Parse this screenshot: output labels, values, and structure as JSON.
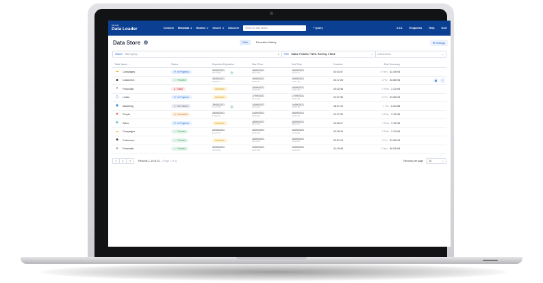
{
  "app": {
    "brand_small": "Mosaic",
    "brand_title": "Data Loader",
    "nav": [
      "Connect",
      "Metadata",
      "Monitor",
      "Secure",
      "Discover"
    ],
    "nav_chevron": [
      "",
      "v",
      "v",
      "v",
      ""
    ],
    "search_placeholder": "Search for data assets...",
    "query_label": "+ Query",
    "right_nav": [
      "2.4.1",
      "Endpoints",
      "Help",
      "User"
    ]
  },
  "page": {
    "title": "Data Store",
    "tabs": [
      "Jobs",
      "Execution History"
    ],
    "active_tab": 0,
    "settings_label": "Settings"
  },
  "filters": {
    "search_label": "Search",
    "search_placeholder": "Start typing...",
    "filter_label": "Filter",
    "filter_value": "Status: Finished, Failed, Running, 3 More",
    "connections_label": "Connections"
  },
  "table": {
    "columns": [
      "Table Name ↑",
      "Status",
      "Expected Expiration",
      "Start Time",
      "End Time",
      "Duration",
      "Disk Summary"
    ],
    "rows": [
      {
        "icon": "☁",
        "icon_color": "#f0b52a",
        "name": "Campaigns",
        "status": "In Progress",
        "status_type": "prog",
        "exp_date": "25/05/2021",
        "exp_time": "09:44:08",
        "exp_cycle": true,
        "start_date": "18/09/2021",
        "start_time": "09:44:08",
        "end_date": "18/09/2021",
        "end_time": "11:22:27",
        "duration": "03:03:47",
        "files": "6 Files",
        "size": "42.45 KB",
        "actions": false
      },
      {
        "icon": "■",
        "icon_color": "#222",
        "name": "Customers",
        "status": "Finished",
        "status_type": "fin",
        "exp_date": "30/05/2021",
        "exp_time": "09:53:17",
        "exp_cycle": false,
        "start_date": "19/09/2021",
        "start_time": "09:53:17",
        "end_date": "19/09/2021",
        "end_time": "13:47:33",
        "duration": "03:17:25",
        "files": "1 File",
        "size": "33.56 KB",
        "actions": true
      },
      {
        "icon": "✈",
        "icon_color": "#8a6d3b",
        "name": "Financials",
        "status": "Failed",
        "status_type": "fail",
        "exp_date": "",
        "exp_time": "",
        "exp_cycle": false,
        "start_date": "15/09/2021",
        "start_time": "12:32:34",
        "end_date": "15/09/2021",
        "end_time": "14:07:23",
        "duration": "03:32:38",
        "files": "2 Files",
        "size": "2.31 KB",
        "actions": false
      },
      {
        "icon": "⬡",
        "icon_color": "#2b7bd6",
        "name": "Leads",
        "status": "In Progress",
        "status_type": "prog",
        "exp_date": "",
        "exp_time": "",
        "exp_cycle": false,
        "start_date": "17/09/2021",
        "start_time": "14:17:03",
        "end_date": "17/09/2021",
        "end_time": "16:24:35",
        "duration": "01:37:35",
        "files": "1 File",
        "size": "23.56 KB",
        "actions": false
      },
      {
        "icon": "◉",
        "icon_color": "#2b7bd6",
        "name": "Marketing",
        "status": "Not Started",
        "status_type": "ns",
        "exp_date": "29/05/2021",
        "exp_time": "14:17:09",
        "exp_cycle": true,
        "start_date": "14/09/2021",
        "start_time": "13:22:27",
        "end_date": "14/09/2021",
        "end_time": "16:48:23",
        "duration": "08:37:19",
        "files": "1 File",
        "size": "4.03 MB",
        "actions": false
      },
      {
        "icon": "▼",
        "icon_color": "#e0453a",
        "name": "People",
        "status": "Cancelled",
        "status_type": "cancel",
        "exp_date": "25/05/2021",
        "exp_time": "10:02:31",
        "exp_cycle": false,
        "start_date": "14/09/2021",
        "start_time": "10:42:11",
        "end_date": "16/09/2021",
        "end_time": "11:47:48",
        "duration": "01:37:32",
        "files": "3 Files",
        "size": "3.76 KB",
        "actions": false
      },
      {
        "icon": "❀",
        "icon_color": "#3aa4c9",
        "name": "Sales",
        "status": "In Progress",
        "status_type": "prog",
        "exp_date": "",
        "exp_time": "",
        "exp_cycle": false,
        "start_date": "18/09/2021",
        "start_time": "11:07:03",
        "end_date": "18/09/2021",
        "end_time": "09:13:57",
        "duration": "04:56:17",
        "files": "7 Files",
        "size": "3.76 KB",
        "actions": false
      },
      {
        "icon": "☁",
        "icon_color": "#f0b52a",
        "name": "Campaigns",
        "status": "Finished",
        "status_type": "fin",
        "exp_date": "26/05/2021",
        "exp_time": "14:47:21",
        "exp_cycle": false,
        "start_date": "15/09/2021",
        "start_time": "10:47:21",
        "end_date": "15/09/2021",
        "end_time": "17:19:25",
        "duration": "02:25:19",
        "files": "5 Files",
        "size": "2.31 KB",
        "actions": false
      },
      {
        "icon": "■",
        "icon_color": "#222",
        "name": "Customers",
        "status": "Finished",
        "status_type": "fin",
        "exp_date": "",
        "exp_time": "",
        "exp_cycle": false,
        "start_date": "15/09/2021",
        "start_time": "12:29:17",
        "end_date": "15/09/2021",
        "end_time": "14:25:32",
        "duration": "03:57:19",
        "files": "1 File",
        "size": "23.56 KB",
        "actions": false
      },
      {
        "icon": "✈",
        "icon_color": "#8a6d3b",
        "name": "Financials",
        "status": "Finished",
        "status_type": "fin",
        "exp_date": "30/05/2021",
        "exp_time": "16:55:56",
        "exp_cycle": false,
        "start_date": "19/09/2021",
        "start_time": "12:57:29",
        "end_date": "19/09/2021",
        "end_time": "11:30:44",
        "duration": "01:15:45",
        "files": "3 Files",
        "size": "49.53 KB",
        "actions": false
      }
    ],
    "unknown_label": "Unknown"
  },
  "pagination": {
    "prev": "<",
    "page": "1",
    "next": ">",
    "records_text": "Records 1–10 of 32",
    "page_text": " – (Page 1 of 4)",
    "per_page_label": "Records per page",
    "per_page_value": "10"
  },
  "colors": {
    "topbar": "#0b3f91",
    "accent": "#1d63d8"
  }
}
